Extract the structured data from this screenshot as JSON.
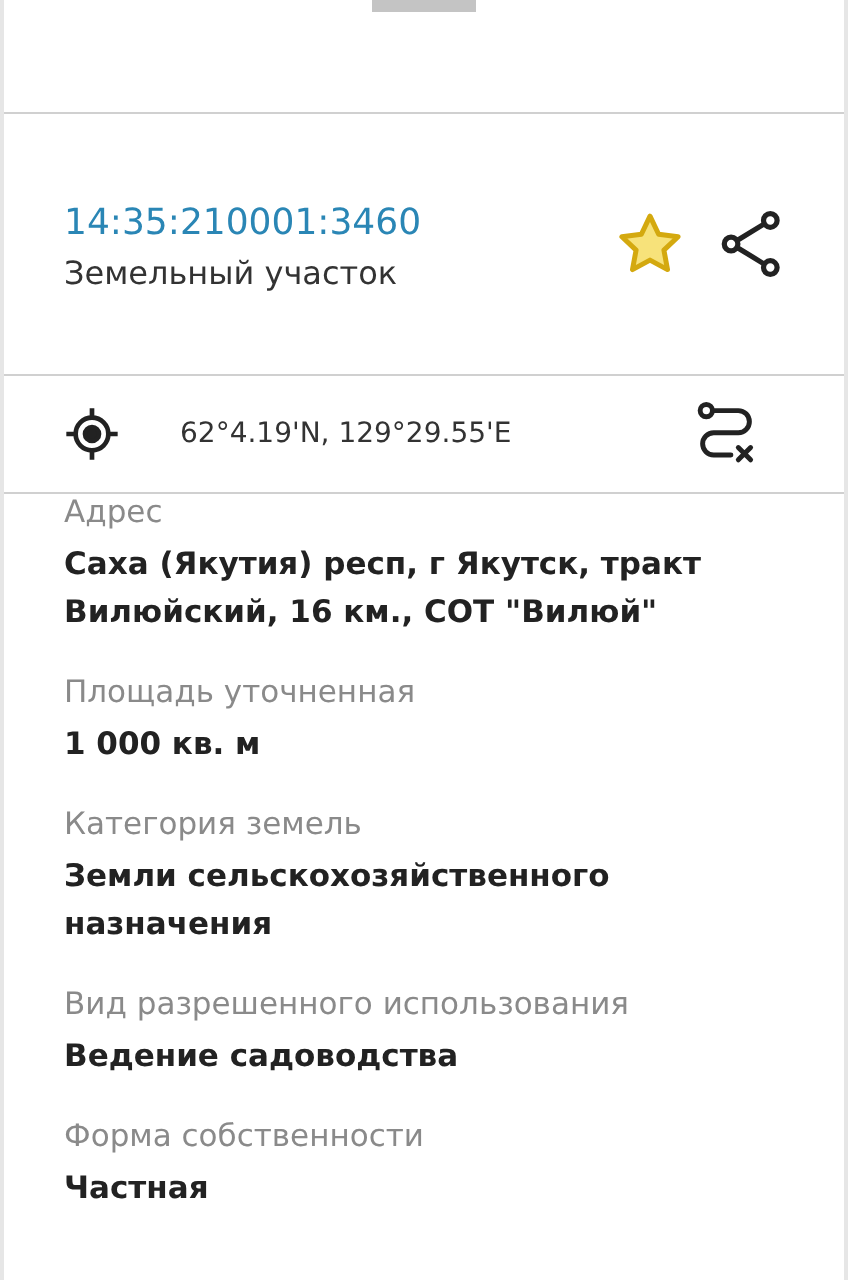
{
  "header": {
    "cadastral_number": "14:35:210001:3460",
    "object_type": "Земельный участок",
    "favorite": true
  },
  "coordinates": "62°4.19'N, 129°29.55'E",
  "fields": [
    {
      "label": "Адрес",
      "value": "Саха (Якутия) респ, г Якутск, тракт Вилюйский, 16 км., СОТ \"Вилюй\""
    },
    {
      "label": "Площадь уточненная",
      "value": "1 000 кв. м"
    },
    {
      "label": "Категория земель",
      "value": "Земли сельскохозяйственного назначения"
    },
    {
      "label": "Вид разрешенного использования",
      "value": "Ведение садоводства"
    },
    {
      "label": "Форма собственности",
      "value": "Частная"
    }
  ]
}
